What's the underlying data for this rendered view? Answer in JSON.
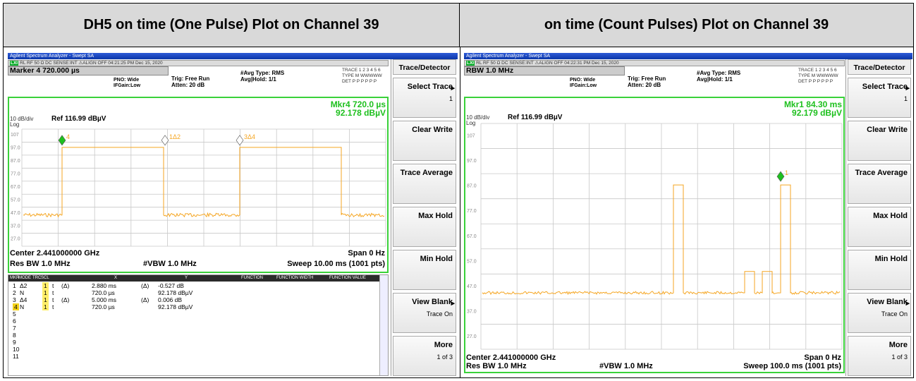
{
  "left_header": "DH5 on time (One Pulse) Plot on Channel 39",
  "right_header": "on time (Count Pulses) Plot on Channel 39",
  "left": {
    "titlebar": "Agilent Spectrum Analyzer - Swept SA",
    "status_strip": "RL    RF   50 Ω  DC          SENSE:INT          ⚠ALIGN OFF   04:21:25 PM Dec 15, 2020",
    "marker_box": "Marker 4 720.000 µs",
    "pno": "PNO: Wide",
    "ifgain": "IFGain:Low",
    "trig": "Trig: Free Run",
    "atten": "Atten: 20 dB",
    "avg_type": "#Avg Type: RMS",
    "avg_hold": "Avg|Hold: 1/1",
    "trace_line": "TRACE 1 2 3 4 5 6",
    "type_line": "TYPE M WWWWW",
    "det_line": "DET P P P P P P",
    "mkr_line1": "Mkr4 720.0 µs",
    "mkr_line2": "92.178 dBµV",
    "dbdiv": "10 dB/div",
    "log": "Log",
    "ref": "Ref 116.99 dBµV",
    "ylabels": [
      "107",
      "97.0",
      "87.0",
      "77.0",
      "67.0",
      "57.0",
      "47.0",
      "37.0",
      "27.0"
    ],
    "marker_labels": [
      "4",
      "1Δ2",
      "3Δ4"
    ],
    "center": "Center 2.441000000 GHz",
    "span": "Span 0 Hz",
    "resbw": "Res BW 1.0 MHz",
    "vbw": "#VBW 1.0 MHz",
    "sweep": "Sweep  10.00 ms (1001 pts)",
    "table_headers": [
      "MKR",
      "MODE",
      "TRC",
      "SCL",
      "X",
      "Y",
      "FUNCTION",
      "FUNCTION WIDTH",
      "FUNCTION VALUE"
    ],
    "table_rows": [
      {
        "n": "1",
        "mode": "Δ2",
        "trc": "1",
        "scl": "t",
        "delta": "(Δ)",
        "x": "2.880 ms",
        "xd": "(Δ)",
        "y": "-0.527 dB"
      },
      {
        "n": "2",
        "mode": "N",
        "trc": "1",
        "scl": "t",
        "delta": "",
        "x": "720.0 µs",
        "xd": "",
        "y": "92.178 dBµV"
      },
      {
        "n": "3",
        "mode": "Δ4",
        "trc": "1",
        "scl": "t",
        "delta": "(Δ)",
        "x": "5.000 ms",
        "xd": "(Δ)",
        "y": "0.006 dB"
      },
      {
        "n": "4",
        "mode": "N",
        "trc": "1",
        "scl": "t",
        "delta": "",
        "x": "720.0 µs",
        "xd": "",
        "y": "92.178 dBµV"
      },
      {
        "n": "5"
      },
      {
        "n": "6"
      },
      {
        "n": "7"
      },
      {
        "n": "8"
      },
      {
        "n": "9"
      },
      {
        "n": "10"
      },
      {
        "n": "11"
      }
    ],
    "softkeys": {
      "header": "Trace/Detector",
      "select_trace": "Select Trace",
      "select_trace_val": "1",
      "clear_write": "Clear Write",
      "trace_average": "Trace Average",
      "max_hold": "Max Hold",
      "min_hold": "Min Hold",
      "view_blank": "View Blank",
      "view_blank_val": "Trace On",
      "more": "More",
      "more_val": "1 of 3"
    }
  },
  "right": {
    "titlebar": "Agilent Spectrum Analyzer - Swept SA",
    "status_strip": "RL    RF   50 Ω  DC          SENSE:INT          ⚠ALIGN OFF   04:22:31 PM Dec 15, 2020",
    "marker_box": "RBW 1.0 MHz",
    "pno": "PNO: Wide",
    "ifgain": "IFGain:Low",
    "trig": "Trig: Free Run",
    "atten": "Atten: 20 dB",
    "avg_type": "#Avg Type: RMS",
    "avg_hold": "Avg|Hold: 1/1",
    "trace_line": "TRACE 1 2 3 4 5 6",
    "type_line": "TYPE M WWWWW",
    "det_line": "DET P P P P P P",
    "mkr_line1": "Mkr1 84.30 ms",
    "mkr_line2": "92.179 dBµV",
    "dbdiv": "10 dB/div",
    "log": "Log",
    "ref": "Ref 116.99 dBµV",
    "ylabels": [
      "107",
      "97.0",
      "87.0",
      "77.0",
      "67.0",
      "57.0",
      "47.0",
      "37.0",
      "27.0"
    ],
    "marker_labels": [
      "1"
    ],
    "center": "Center 2.441000000 GHz",
    "span": "Span 0 Hz",
    "resbw": "Res BW 1.0 MHz",
    "vbw": "#VBW 1.0 MHz",
    "sweep": "Sweep  100.0 ms (1001 pts)",
    "softkeys": {
      "header": "Trace/Detector",
      "select_trace": "Select Trace",
      "select_trace_val": "1",
      "clear_write": "Clear Write",
      "trace_average": "Trace Average",
      "max_hold": "Max Hold",
      "min_hold": "Min Hold",
      "view_blank": "View Blank",
      "view_blank_val": "Trace On",
      "more": "More",
      "more_val": "1 of 3"
    }
  },
  "colors": {
    "trace": "#f5a623",
    "graticule": "#32d232",
    "marker_active": "#1ec01e",
    "titlebar": "#1d4bc4"
  }
}
